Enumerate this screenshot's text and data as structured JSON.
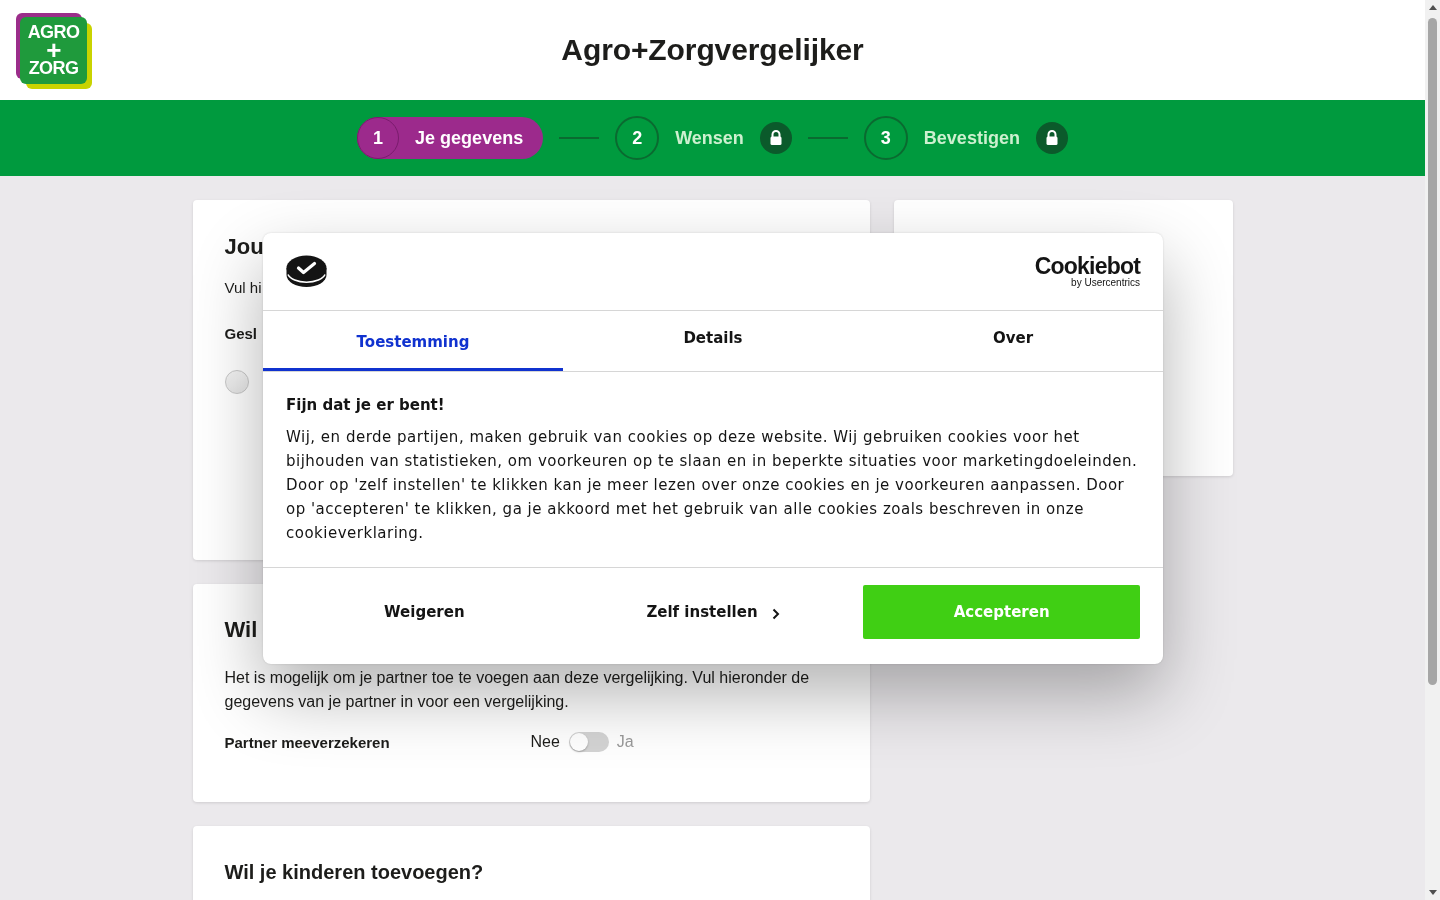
{
  "header": {
    "logo_lines": [
      "AGRO",
      "+",
      "ZORG"
    ],
    "title": "Agro+Zorgvergelijker"
  },
  "steps": [
    {
      "number": "1",
      "label": "Je gegevens",
      "selected": true,
      "locked": false
    },
    {
      "number": "2",
      "label": "Wensen",
      "selected": false,
      "locked": true
    },
    {
      "number": "3",
      "label": "Bevestigen",
      "selected": false,
      "locked": true
    }
  ],
  "personal_card": {
    "title": "Jou",
    "intro": "Vul hi",
    "field_label": "Gesl",
    "gender_options": [
      {
        "selected": false
      }
    ]
  },
  "partner_card": {
    "title": "Wil",
    "intro": "Het is mogelijk om je partner toe te voegen aan deze vergelijking. Vul hieronder de gegevens van je partner in voor een vergelijking.",
    "toggle": {
      "label": "Partner meeverzekeren",
      "off_label": "Nee",
      "on_label": "Ja",
      "on": false
    }
  },
  "children_card": {
    "title": "Wil je kinderen toevoegen?"
  },
  "cookie_dialog": {
    "brand": {
      "name": "Cookiebot",
      "byline": "by Usercentrics"
    },
    "tabs": [
      {
        "label": "Toestemming",
        "selected": true
      },
      {
        "label": "Details",
        "selected": false
      },
      {
        "label": "Over",
        "selected": false
      }
    ],
    "heading": "Fijn dat je er bent!",
    "body": "Wij, en derde partijen, maken gebruik van cookies op deze website. Wij gebruiken cookies voor het bijhouden van statistieken, om voorkeuren op te slaan en in beperkte situaties voor marketingdoeleinden. Door op 'zelf instellen' te klikken kan je meer lezen over onze cookies en je voorkeuren aanpassen. Door op 'accepteren' te klikken, ga je akkoord met het gebruik van alle cookies zoals beschreven in onze cookieverklaring.",
    "buttons": [
      {
        "label": "Weigeren",
        "kind": "plain"
      },
      {
        "label": "Zelf instellen",
        "kind": "chevron"
      },
      {
        "label": "Accepteren",
        "kind": "primary"
      }
    ]
  }
}
